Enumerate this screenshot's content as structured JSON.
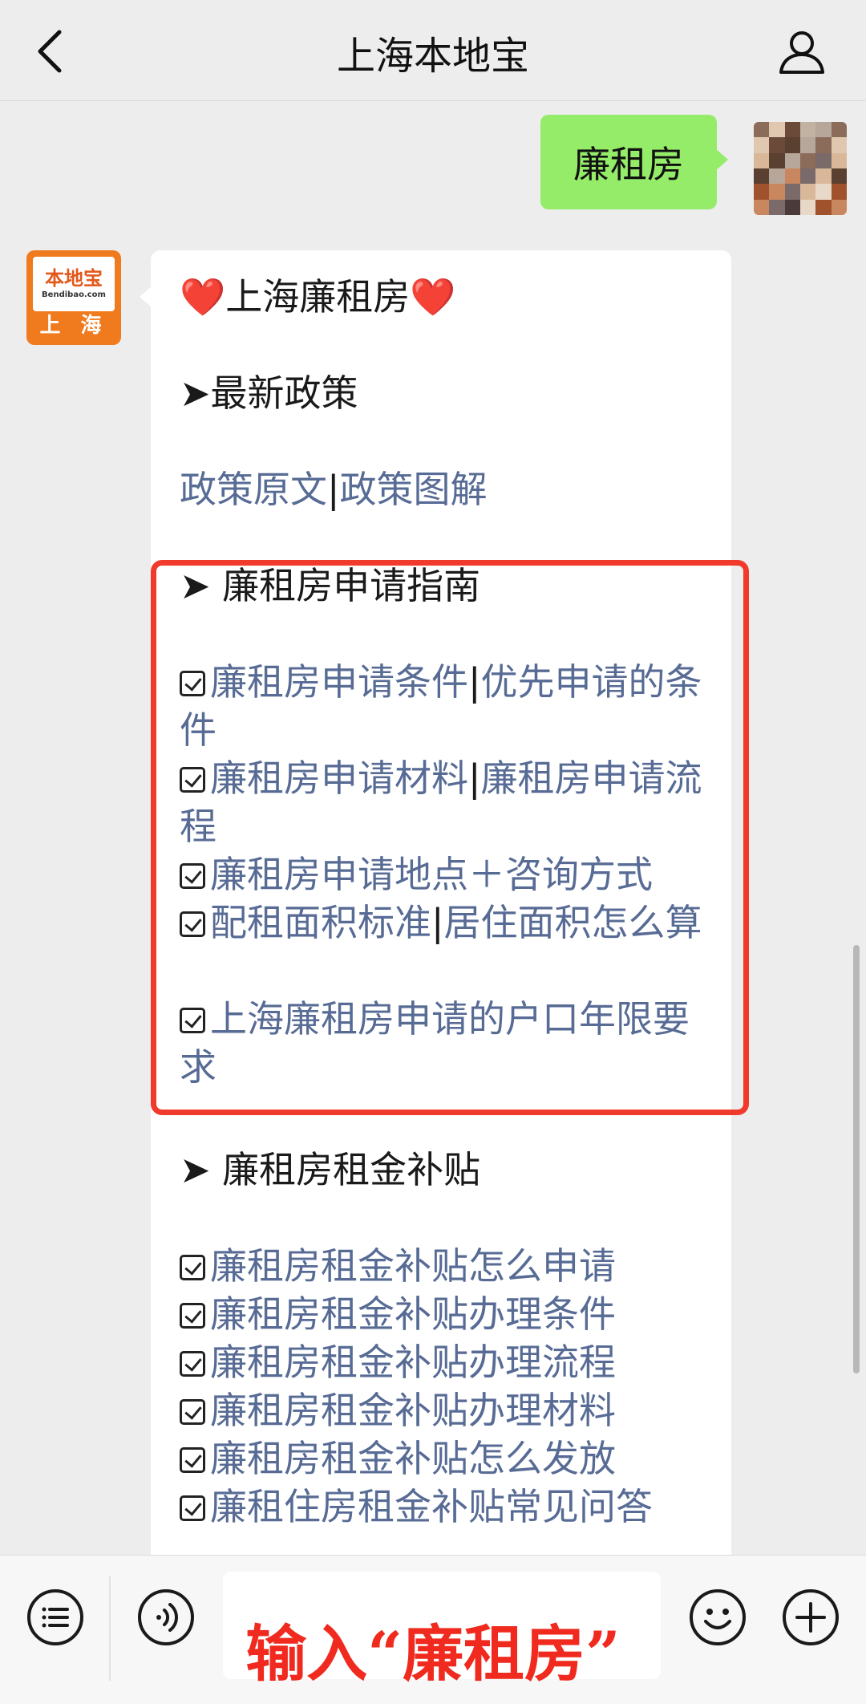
{
  "nav": {
    "title": "上海本地宝"
  },
  "outgoing": {
    "text": "廉租房"
  },
  "bot": {
    "logo_name": "本地宝",
    "logo_url": "Bendibao.com",
    "logo_city": "上 海"
  },
  "message": {
    "title_heart": "❤️",
    "title": "上海廉租房",
    "section1": {
      "heading": "➤最新政策",
      "links": [
        "政策原文",
        "政策图解"
      ]
    },
    "section2": {
      "heading": "➤ 廉租房申请指南",
      "items": [
        {
          "a": "廉租房申请条件",
          "b": "优先申请的条件"
        },
        {
          "a": "廉租房申请材料",
          "b": "廉租房申请流程"
        },
        {
          "a": "廉租房申请地点＋咨询方式"
        },
        {
          "a": "配租面积标准",
          "b": "居住面积怎么算"
        },
        {
          "a": "上海廉租房申请的户口年限要求"
        }
      ]
    },
    "section3": {
      "heading": "➤ 廉租房租金补贴",
      "items": [
        "廉租房租金补贴怎么申请",
        "廉租房租金补贴办理条件",
        "廉租房租金补贴办理流程",
        "廉租房租金补贴办理材料",
        "廉租房租金补贴怎么发放",
        "廉租住房租金补贴常见问答"
      ]
    }
  },
  "annotation": "输入“廉租房”",
  "colors": {
    "link": "#576b95",
    "bubble_out": "#95ec69",
    "highlight": "#f03a2c"
  },
  "icons": [
    "back-chevron-icon",
    "profile-icon",
    "menu-list-icon",
    "voice-icon",
    "emoji-icon",
    "plus-icon",
    "checkbox-icon"
  ]
}
